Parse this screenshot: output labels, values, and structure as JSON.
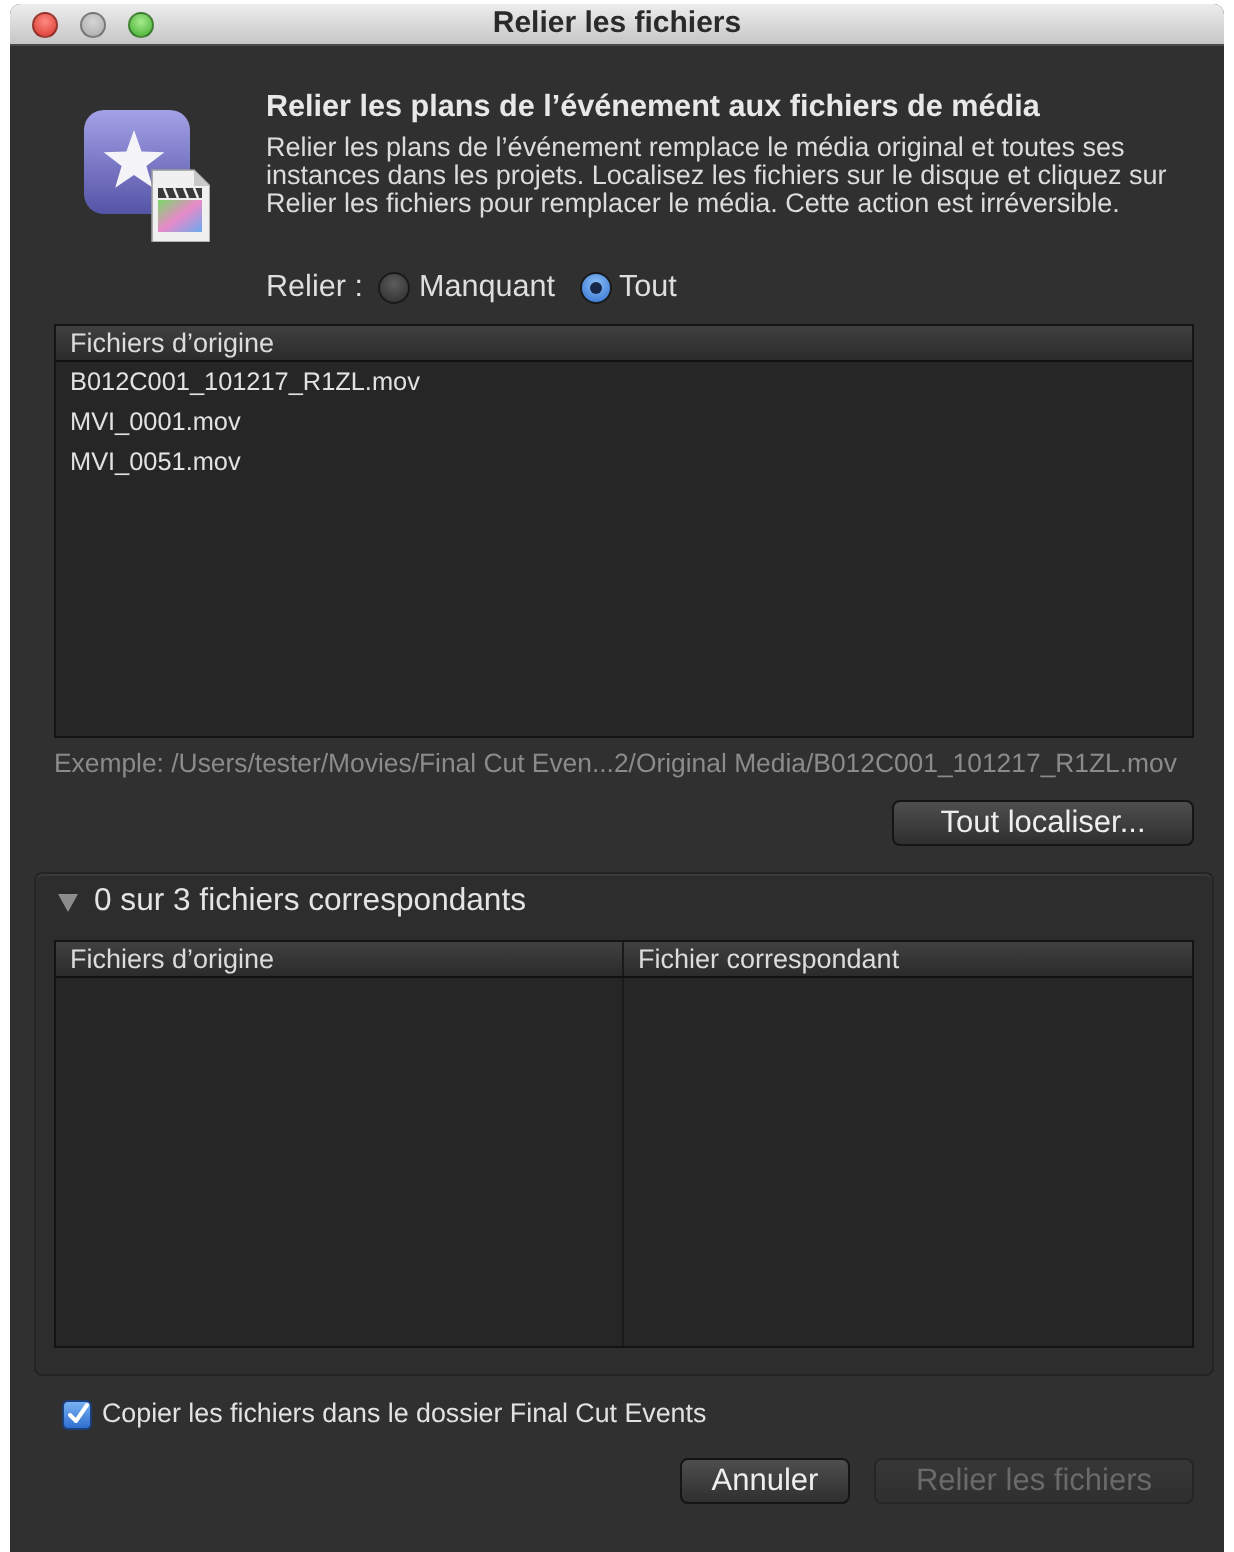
{
  "window": {
    "title": "Relier les fichiers",
    "traffic_lights": [
      {
        "kind": "close",
        "disabled": false
      },
      {
        "kind": "minimize",
        "disabled": true
      },
      {
        "kind": "zoom",
        "disabled": false
      }
    ]
  },
  "header": {
    "title": "Relier les plans de l’événement aux fichiers de média",
    "description": "Relier les plans de l’événement remplace le média original et toutes ses instances dans les projets. Localisez les fichiers sur le disque et cliquez sur Relier les fichiers pour remplacer le média. Cette action est irréversible."
  },
  "relink": {
    "label": "Relier :",
    "options": [
      {
        "label": "Manquant",
        "selected": false
      },
      {
        "label": "Tout",
        "selected": true
      }
    ]
  },
  "source_table": {
    "columns": [
      "Fichiers d’origine"
    ],
    "rows": [
      "B012C001_101217_R1ZL.mov",
      "MVI_0001.mov",
      "MVI_0051.mov"
    ]
  },
  "example_path": "Exemple: /Users/tester/Movies/Final Cut Even...2/Original Media/B012C001_101217_R1ZL.mov",
  "locate_button": {
    "label": "Tout localiser..."
  },
  "matches": {
    "title": "0 sur 3 fichiers correspondants",
    "expanded": true,
    "columns": [
      "Fichiers d’origine",
      "Fichier correspondant"
    ]
  },
  "copy_option": {
    "label": "Copier les fichiers dans le dossier Final Cut Events",
    "checked": true
  },
  "buttons": [
    {
      "label": "Annuler",
      "disabled": false
    },
    {
      "label": "Relier les fichiers",
      "disabled": true
    }
  ]
}
